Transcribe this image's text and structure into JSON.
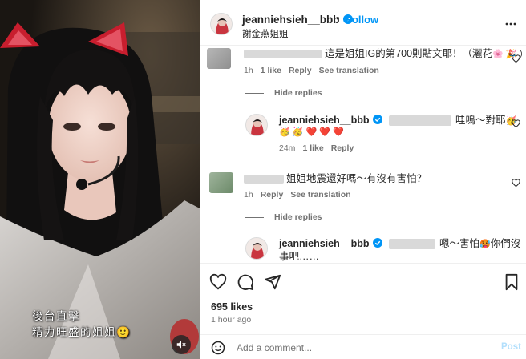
{
  "media": {
    "caption_line1": "後台直擊",
    "caption_line2": "精力旺盛的姐姐",
    "caption_emoji": "🙂"
  },
  "header": {
    "username": "jeanniehsieh__bbb",
    "follow_label": "Follow",
    "location": "謝金燕姐姐"
  },
  "comments": [
    {
      "text": "這是姐姐IG的第700則貼文耶！（灑花",
      "emoji_tail": "🌸 🎉 ）",
      "time": "1h",
      "likes": "1 like",
      "reply_label": "Reply",
      "translation_label": "See translation",
      "hide_replies": "Hide replies",
      "reply": {
        "username": "jeanniehsieh__bbb",
        "text": "哇嗚～對耶",
        "line2_hearts": "❤️ ❤️ ❤️",
        "time": "24m",
        "likes": "1 like",
        "reply_label": "Reply"
      }
    },
    {
      "text": "姐姐地震還好嗎～有沒有害怕？",
      "time": "1h",
      "reply_label": "Reply",
      "translation_label": "See translation",
      "hide_replies": "Hide replies",
      "reply": {
        "username": "jeanniehsieh__bbb",
        "text": "嗯～害怕",
        "text_tail": "你們沒",
        "line2": "事吧……"
      }
    }
  ],
  "actions": {
    "likes": "695 likes",
    "time": "1 hour ago",
    "comment_placeholder": "Add a comment...",
    "post_label": "Post"
  },
  "colors": {
    "follow": "#0095f6",
    "post_disabled": "#b2dffc",
    "secondary_text": "#737373"
  },
  "icons": [
    "verified-icon",
    "more-icon",
    "heart-icon",
    "comment-icon",
    "share-icon",
    "save-icon",
    "smile-icon",
    "mute-icon"
  ]
}
